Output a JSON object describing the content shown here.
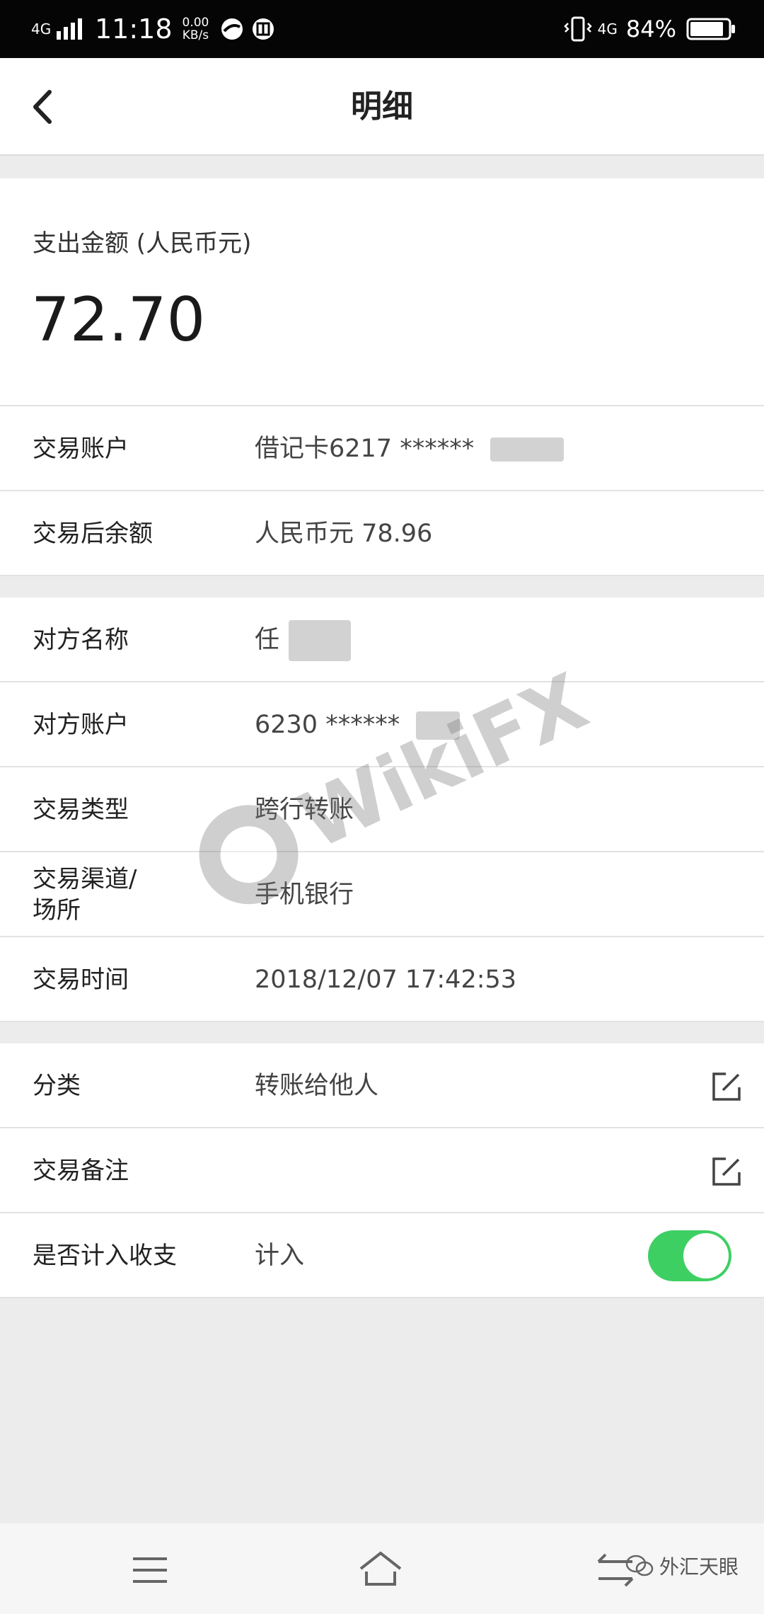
{
  "status_bar": {
    "network_left": "4G",
    "time": "11:18",
    "speed_value": "0.00",
    "speed_unit": "KB/s",
    "network_right": "4G",
    "battery": "84%"
  },
  "header": {
    "title": "明细"
  },
  "amount": {
    "label": "支出金额 (人民币元)",
    "value": "72.70"
  },
  "account_group": [
    {
      "label": "交易账户",
      "value": "借记卡6217 ******"
    },
    {
      "label": "交易后余额",
      "value": "人民币元 78.96"
    }
  ],
  "details_group": [
    {
      "label": "对方名称",
      "value": "任"
    },
    {
      "label": "对方账户",
      "value": "6230 ******"
    },
    {
      "label": "交易类型",
      "value": "跨行转账"
    },
    {
      "label": "交易渠道/\n场所",
      "value": "手机银行"
    },
    {
      "label": "交易时间",
      "value": "2018/12/07 17:42:53"
    }
  ],
  "settings_group": [
    {
      "label": "分类",
      "value": "转账给他人"
    },
    {
      "label": "交易备注",
      "value": ""
    },
    {
      "label": "是否计入收支",
      "value": "计入",
      "toggle_on": true
    }
  ],
  "watermark": {
    "text": "WikiFX"
  },
  "footer": {
    "brand": "外汇天眼"
  },
  "colors": {
    "toggle": "#3ecf63",
    "background": "#ececec"
  }
}
